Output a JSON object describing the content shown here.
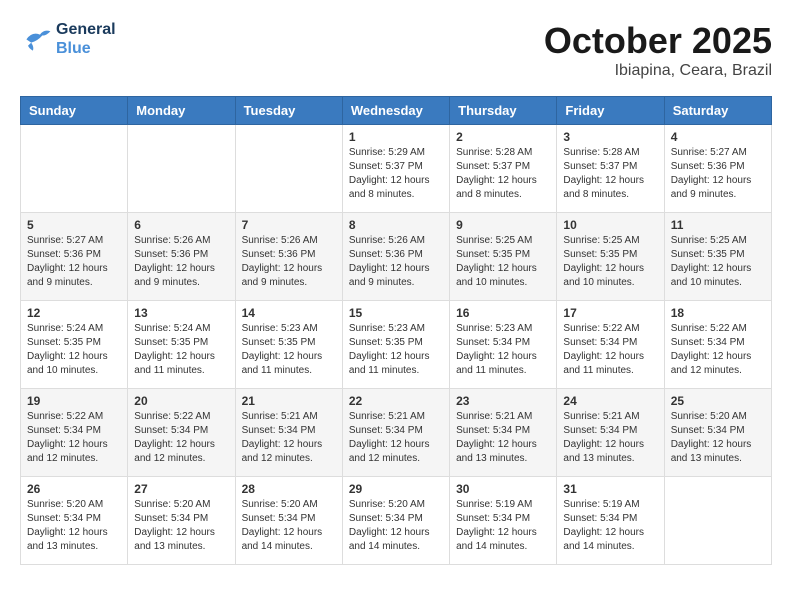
{
  "header": {
    "logo_line1": "General",
    "logo_line2": "Blue",
    "month_year": "October 2025",
    "location": "Ibiapina, Ceara, Brazil"
  },
  "weekdays": [
    "Sunday",
    "Monday",
    "Tuesday",
    "Wednesday",
    "Thursday",
    "Friday",
    "Saturday"
  ],
  "weeks": [
    [
      {
        "day": "",
        "info": ""
      },
      {
        "day": "",
        "info": ""
      },
      {
        "day": "",
        "info": ""
      },
      {
        "day": "1",
        "info": "Sunrise: 5:29 AM\nSunset: 5:37 PM\nDaylight: 12 hours\nand 8 minutes."
      },
      {
        "day": "2",
        "info": "Sunrise: 5:28 AM\nSunset: 5:37 PM\nDaylight: 12 hours\nand 8 minutes."
      },
      {
        "day": "3",
        "info": "Sunrise: 5:28 AM\nSunset: 5:37 PM\nDaylight: 12 hours\nand 8 minutes."
      },
      {
        "day": "4",
        "info": "Sunrise: 5:27 AM\nSunset: 5:36 PM\nDaylight: 12 hours\nand 9 minutes."
      }
    ],
    [
      {
        "day": "5",
        "info": "Sunrise: 5:27 AM\nSunset: 5:36 PM\nDaylight: 12 hours\nand 9 minutes."
      },
      {
        "day": "6",
        "info": "Sunrise: 5:26 AM\nSunset: 5:36 PM\nDaylight: 12 hours\nand 9 minutes."
      },
      {
        "day": "7",
        "info": "Sunrise: 5:26 AM\nSunset: 5:36 PM\nDaylight: 12 hours\nand 9 minutes."
      },
      {
        "day": "8",
        "info": "Sunrise: 5:26 AM\nSunset: 5:36 PM\nDaylight: 12 hours\nand 9 minutes."
      },
      {
        "day": "9",
        "info": "Sunrise: 5:25 AM\nSunset: 5:35 PM\nDaylight: 12 hours\nand 10 minutes."
      },
      {
        "day": "10",
        "info": "Sunrise: 5:25 AM\nSunset: 5:35 PM\nDaylight: 12 hours\nand 10 minutes."
      },
      {
        "day": "11",
        "info": "Sunrise: 5:25 AM\nSunset: 5:35 PM\nDaylight: 12 hours\nand 10 minutes."
      }
    ],
    [
      {
        "day": "12",
        "info": "Sunrise: 5:24 AM\nSunset: 5:35 PM\nDaylight: 12 hours\nand 10 minutes."
      },
      {
        "day": "13",
        "info": "Sunrise: 5:24 AM\nSunset: 5:35 PM\nDaylight: 12 hours\nand 11 minutes."
      },
      {
        "day": "14",
        "info": "Sunrise: 5:23 AM\nSunset: 5:35 PM\nDaylight: 12 hours\nand 11 minutes."
      },
      {
        "day": "15",
        "info": "Sunrise: 5:23 AM\nSunset: 5:35 PM\nDaylight: 12 hours\nand 11 minutes."
      },
      {
        "day": "16",
        "info": "Sunrise: 5:23 AM\nSunset: 5:34 PM\nDaylight: 12 hours\nand 11 minutes."
      },
      {
        "day": "17",
        "info": "Sunrise: 5:22 AM\nSunset: 5:34 PM\nDaylight: 12 hours\nand 11 minutes."
      },
      {
        "day": "18",
        "info": "Sunrise: 5:22 AM\nSunset: 5:34 PM\nDaylight: 12 hours\nand 12 minutes."
      }
    ],
    [
      {
        "day": "19",
        "info": "Sunrise: 5:22 AM\nSunset: 5:34 PM\nDaylight: 12 hours\nand 12 minutes."
      },
      {
        "day": "20",
        "info": "Sunrise: 5:22 AM\nSunset: 5:34 PM\nDaylight: 12 hours\nand 12 minutes."
      },
      {
        "day": "21",
        "info": "Sunrise: 5:21 AM\nSunset: 5:34 PM\nDaylight: 12 hours\nand 12 minutes."
      },
      {
        "day": "22",
        "info": "Sunrise: 5:21 AM\nSunset: 5:34 PM\nDaylight: 12 hours\nand 12 minutes."
      },
      {
        "day": "23",
        "info": "Sunrise: 5:21 AM\nSunset: 5:34 PM\nDaylight: 12 hours\nand 13 minutes."
      },
      {
        "day": "24",
        "info": "Sunrise: 5:21 AM\nSunset: 5:34 PM\nDaylight: 12 hours\nand 13 minutes."
      },
      {
        "day": "25",
        "info": "Sunrise: 5:20 AM\nSunset: 5:34 PM\nDaylight: 12 hours\nand 13 minutes."
      }
    ],
    [
      {
        "day": "26",
        "info": "Sunrise: 5:20 AM\nSunset: 5:34 PM\nDaylight: 12 hours\nand 13 minutes."
      },
      {
        "day": "27",
        "info": "Sunrise: 5:20 AM\nSunset: 5:34 PM\nDaylight: 12 hours\nand 13 minutes."
      },
      {
        "day": "28",
        "info": "Sunrise: 5:20 AM\nSunset: 5:34 PM\nDaylight: 12 hours\nand 14 minutes."
      },
      {
        "day": "29",
        "info": "Sunrise: 5:20 AM\nSunset: 5:34 PM\nDaylight: 12 hours\nand 14 minutes."
      },
      {
        "day": "30",
        "info": "Sunrise: 5:19 AM\nSunset: 5:34 PM\nDaylight: 12 hours\nand 14 minutes."
      },
      {
        "day": "31",
        "info": "Sunrise: 5:19 AM\nSunset: 5:34 PM\nDaylight: 12 hours\nand 14 minutes."
      },
      {
        "day": "",
        "info": ""
      }
    ]
  ]
}
